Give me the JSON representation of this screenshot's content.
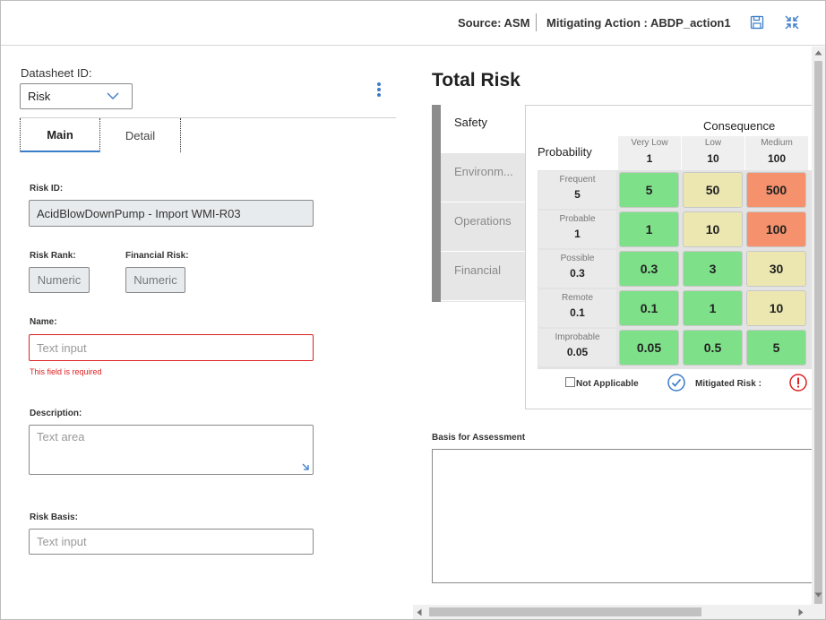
{
  "header": {
    "source": "Source: ASM",
    "mitigating_action": "Mitigating Action : ABDP_action1",
    "save_icon": "save-icon",
    "collapse_icon": "collapse-icon"
  },
  "left": {
    "datasheet_label": "Datasheet ID:",
    "datasheet_value": "Risk",
    "tabs": [
      {
        "label": "Main",
        "active": true
      },
      {
        "label": "Detail",
        "active": false
      }
    ],
    "risk_id": {
      "label": "Risk ID:",
      "value": "AcidBlowDownPump - Import WMI-R03"
    },
    "risk_rank": {
      "label": "Risk Rank:",
      "placeholder": "Numeric"
    },
    "financial_risk": {
      "label": "Financial Risk:",
      "placeholder": "Numeric"
    },
    "name": {
      "label": "Name:",
      "placeholder": "Text input",
      "error": "This field is required"
    },
    "description": {
      "label": "Description:",
      "placeholder": "Text area"
    },
    "risk_basis": {
      "label": "Risk Basis:",
      "placeholder": "Text input"
    }
  },
  "right": {
    "title": "Total Risk",
    "categories": [
      {
        "label": "Safety",
        "active": true
      },
      {
        "label": "Environm...",
        "active": false
      },
      {
        "label": "Operations",
        "active": false
      },
      {
        "label": "Financial",
        "active": false
      }
    ],
    "consequence_title": "Consequence",
    "probability_title": "Probability",
    "consequence_columns": [
      {
        "name": "Very Low",
        "value": "1"
      },
      {
        "name": "Low",
        "value": "10"
      },
      {
        "name": "Medium",
        "value": "100"
      }
    ],
    "probability_rows": [
      {
        "name": "Frequent",
        "value": "5",
        "cells": [
          "5",
          "50",
          "500"
        ]
      },
      {
        "name": "Probable",
        "value": "1",
        "cells": [
          "1",
          "10",
          "100"
        ]
      },
      {
        "name": "Possible",
        "value": "0.3",
        "cells": [
          "0.3",
          "3",
          "30"
        ]
      },
      {
        "name": "Remote",
        "value": "0.1",
        "cells": [
          "0.1",
          "1",
          "10"
        ]
      },
      {
        "name": "Improbable",
        "value": "0.05",
        "cells": [
          "0.05",
          "0.5",
          "5"
        ]
      }
    ],
    "cell_colors": {
      "green": "#7fe08a",
      "yellow": "#ece7b0",
      "orange": "#f5916c"
    },
    "not_applicable_label": "Not Applicable",
    "mitigated_risk_label": "Mitigated Risk :",
    "basis_label": "Basis for Assessment"
  }
}
